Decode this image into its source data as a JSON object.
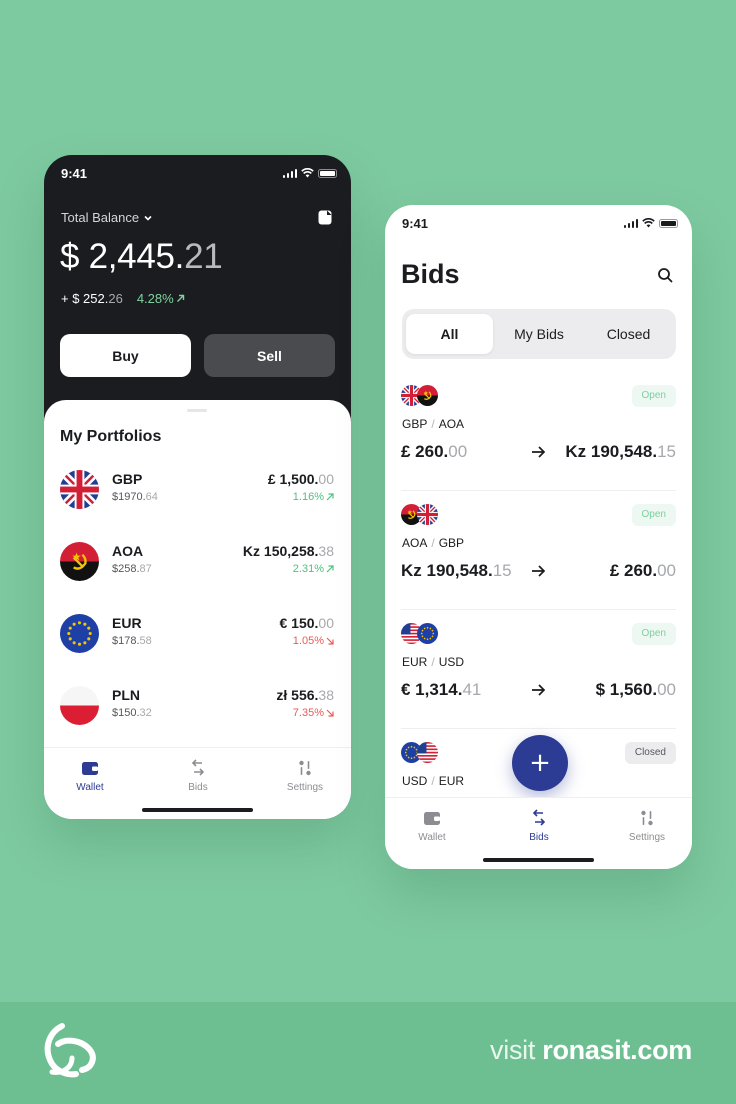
{
  "left_phone": {
    "status_time": "9:41",
    "total_balance_label": "Total Balance",
    "balance_main": "$ 2,445.",
    "balance_dec": "21",
    "change_main": "+ $ 252.",
    "change_dec": "26",
    "change_pct": "4.28%",
    "buy_label": "Buy",
    "sell_label": "Sell",
    "portfolios_title": "My Portfolios",
    "portfolios": [
      {
        "code": "GBP",
        "usd_main": "$1970.",
        "usd_dec": "64",
        "amount_main": "£ 1,500.",
        "amount_dec": "00",
        "pct": "1.16%",
        "trend": "up"
      },
      {
        "code": "AOA",
        "usd_main": "$258.",
        "usd_dec": "87",
        "amount_main": "Kz 150,258.",
        "amount_dec": "38",
        "pct": "2.31%",
        "trend": "up"
      },
      {
        "code": "EUR",
        "usd_main": "$178.",
        "usd_dec": "58",
        "amount_main": "€ 150.",
        "amount_dec": "00",
        "pct": "1.05%",
        "trend": "down"
      },
      {
        "code": "PLN",
        "usd_main": "$150.",
        "usd_dec": "32",
        "amount_main": "zł 556.",
        "amount_dec": "38",
        "pct": "7.35%",
        "trend": "down"
      }
    ],
    "tabs": {
      "wallet": "Wallet",
      "bids": "Bids",
      "settings": "Settings"
    },
    "active_tab": "wallet"
  },
  "right_phone": {
    "status_time": "9:41",
    "title": "Bids",
    "segments": [
      "All",
      "My Bids",
      "Closed"
    ],
    "active_segment": "All",
    "bids": [
      {
        "from_code": "GBP",
        "to_code": "AOA",
        "status": "Open",
        "from_main": "£ 260.",
        "from_dec": "00",
        "to_main": "Kz 190,548.",
        "to_dec": "15"
      },
      {
        "from_code": "AOA",
        "to_code": "GBP",
        "status": "Open",
        "from_main": "Kz 190,548.",
        "from_dec": "15",
        "to_main": "£ 260.",
        "to_dec": "00"
      },
      {
        "from_code": "EUR",
        "to_code": "USD",
        "status": "Open",
        "from_main": "€ 1,314.",
        "from_dec": "41",
        "to_main": "$ 1,560.",
        "to_dec": "00"
      },
      {
        "from_code": "USD",
        "to_code": "EUR",
        "status": "Closed"
      }
    ],
    "fab_label": "+",
    "tabs": {
      "wallet": "Wallet",
      "bids": "Bids",
      "settings": "Settings"
    },
    "active_tab": "bids"
  },
  "footer": {
    "visit_prefix": "visit ",
    "domain": "ronasit.com"
  },
  "colors": {
    "background": "#7ecaa0",
    "footer_band": "#6dbf91",
    "dark_panel": "#1b1c1f",
    "accent_blue": "#2c3b93",
    "positive": "#4ec17f",
    "negative": "#ea5a55"
  }
}
